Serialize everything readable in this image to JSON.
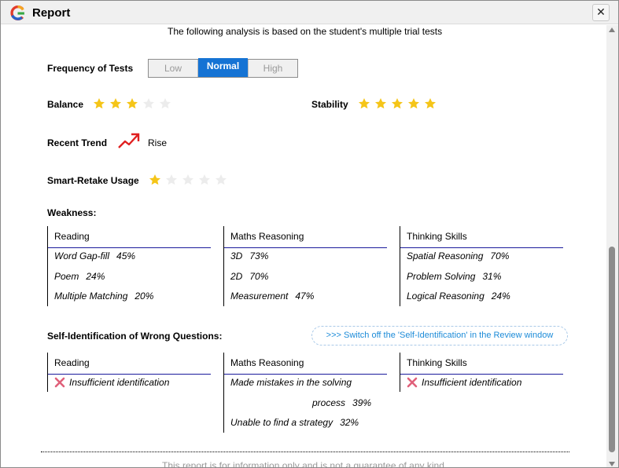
{
  "window": {
    "title": "Report",
    "close_label": "✕"
  },
  "intro": "The following analysis is based on the student's multiple trial tests",
  "frequency": {
    "label": "Frequency of Tests",
    "options": [
      "Low",
      "Normal",
      "High"
    ],
    "selected": "Normal"
  },
  "balance": {
    "label": "Balance",
    "stars": 3,
    "max": 5
  },
  "stability": {
    "label": "Stability",
    "stars": 5,
    "max": 5
  },
  "trend": {
    "label": "Recent Trend",
    "value": "Rise",
    "icon": "trend-up-icon"
  },
  "smart_retake": {
    "label": "Smart-Retake Usage",
    "stars": 1,
    "max": 5
  },
  "weakness": {
    "title": "Weakness:",
    "columns": [
      {
        "header": "Reading",
        "items": [
          {
            "name": "Word Gap-fill",
            "pct": "45%"
          },
          {
            "name": "Poem",
            "pct": "24%"
          },
          {
            "name": "Multiple Matching",
            "pct": "20%"
          }
        ]
      },
      {
        "header": "Maths Reasoning",
        "items": [
          {
            "name": "3D",
            "pct": "73%"
          },
          {
            "name": "2D",
            "pct": "70%"
          },
          {
            "name": "Measurement",
            "pct": "47%"
          }
        ]
      },
      {
        "header": "Thinking Skills",
        "items": [
          {
            "name": "Spatial Reasoning",
            "pct": "70%"
          },
          {
            "name": "Problem Solving",
            "pct": "31%"
          },
          {
            "name": "Logical Reasoning",
            "pct": "24%"
          }
        ]
      }
    ]
  },
  "self_id": {
    "title": "Self-Identification of Wrong Questions:",
    "switch_label": ">>> Switch off the 'Self-Identification' in the Review window",
    "columns": [
      {
        "header": "Reading",
        "line1": "Insufficient identification"
      },
      {
        "header": "Maths Reasoning",
        "line1": "Made mistakes in the solving",
        "line2": "process",
        "line2_pct": "39%",
        "line3": "Unable to find a strategy",
        "line3_pct": "32%"
      },
      {
        "header": "Thinking Skills",
        "line1": "Insufficient identification"
      }
    ]
  },
  "footer": "This report is for information only and is not a guarantee of any kind.",
  "colors": {
    "accent": "#1573d4",
    "star_on": "#f5c518",
    "star_off": "#ececec",
    "cross": "#e0607a",
    "trend": "#e02020"
  }
}
